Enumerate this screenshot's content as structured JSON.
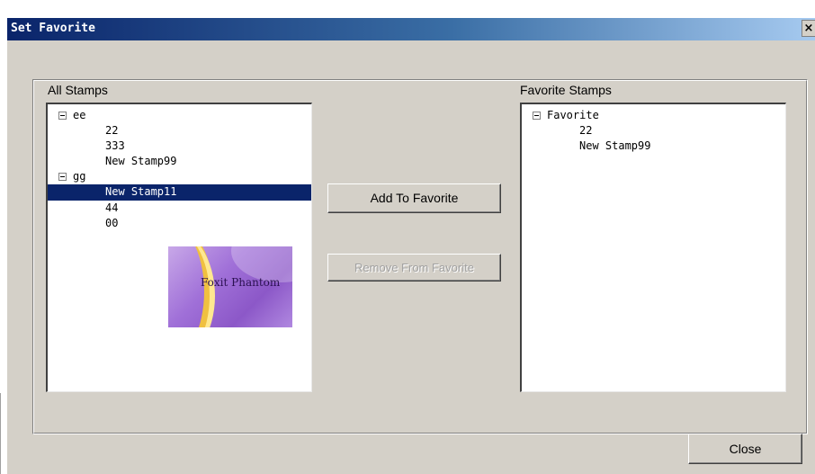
{
  "dialog": {
    "title": "Set Favorite",
    "close_x": "×"
  },
  "all_stamps": {
    "label": "All Stamps",
    "items": [
      {
        "text": "ee",
        "level": 0,
        "expanded": true
      },
      {
        "text": "22",
        "level": 1
      },
      {
        "text": "333",
        "level": 1
      },
      {
        "text": "New Stamp99",
        "level": 1
      },
      {
        "text": "gg",
        "level": 0,
        "expanded": true
      },
      {
        "text": "New Stamp11",
        "level": 1,
        "selected": true
      },
      {
        "text": "44",
        "level": 1
      },
      {
        "text": "00",
        "level": 1
      }
    ],
    "preview_text": "Foxit Phantom"
  },
  "favorite_stamps": {
    "label": "Favorite Stamps",
    "items": [
      {
        "text": "Favorite",
        "level": 0,
        "expanded": true
      },
      {
        "text": "22",
        "level": 1
      },
      {
        "text": "New Stamp99",
        "level": 1
      }
    ]
  },
  "buttons": {
    "add": "Add To Favorite",
    "remove": "Remove From Favorite",
    "close": "Close"
  },
  "colors": {
    "selection": "#0a246a",
    "dialog_face": "#d4d0c8"
  }
}
